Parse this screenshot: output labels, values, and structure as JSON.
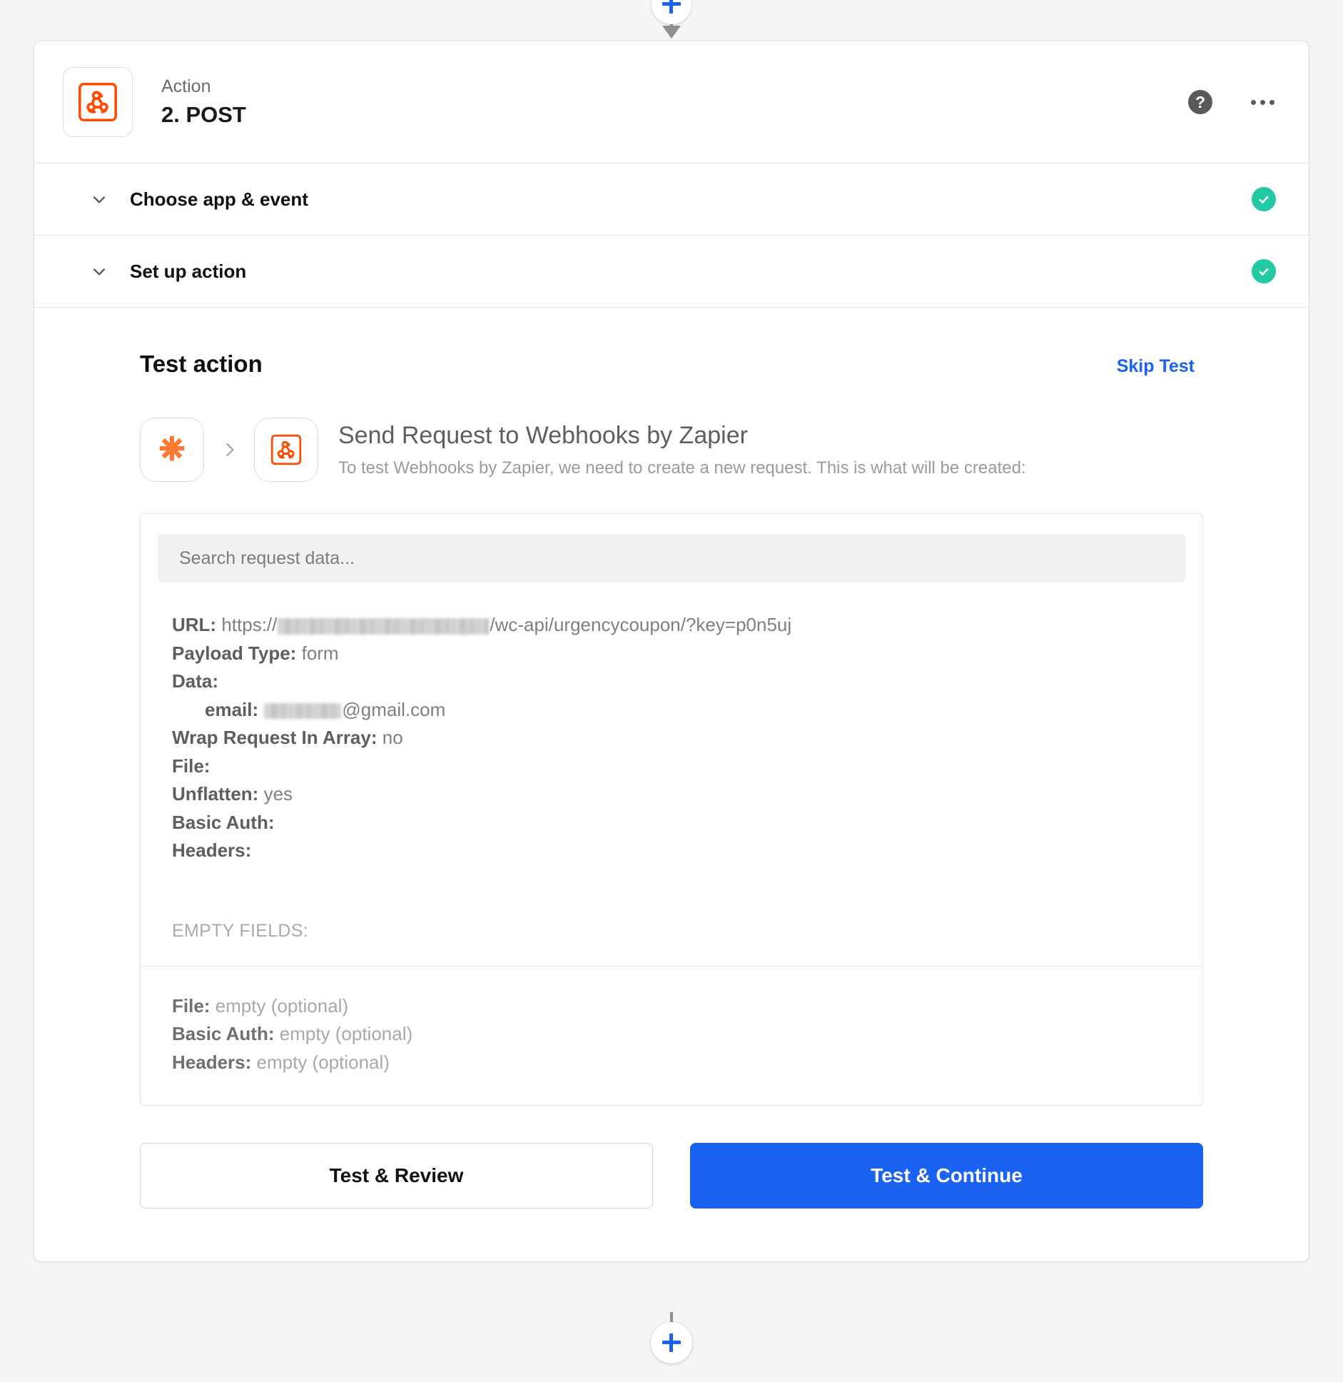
{
  "flow": {
    "add_step_top_label": "+",
    "add_step_bottom_label": "+"
  },
  "header": {
    "kicker": "Action",
    "title": "2. POST",
    "app_icon": "webhooks-icon",
    "help_icon": "?",
    "more_icon": "ellipsis-icon"
  },
  "sections": [
    {
      "label": "Choose app & event",
      "status": "complete",
      "chevron": "chevron-down-icon",
      "check": "✓"
    },
    {
      "label": "Set up action",
      "status": "complete",
      "chevron": "chevron-down-icon",
      "check": "✓"
    }
  ],
  "test_action": {
    "title": "Test action",
    "skip_label": "Skip Test",
    "send_title": "Send Request to Webhooks by Zapier",
    "send_subtitle": "To test Webhooks by Zapier, we need to create a new request. This is what will be created:",
    "zapier_icon": "zapier-logo-icon",
    "arrow_icon": "chevron-right-icon",
    "webhooks_icon": "webhooks-icon",
    "search": {
      "placeholder": "Search request data...",
      "value": ""
    },
    "request_fields": {
      "url_key": "URL:",
      "url_prefix": "https://",
      "url_redacted": true,
      "url_suffix": "/wc-api/urgencycoupon/?key=p0n5uj",
      "payload_type_key": "Payload Type:",
      "payload_type_value": "form",
      "data_key": "Data:",
      "email_key": "email:",
      "email_redacted": true,
      "email_suffix": "@gmail.com",
      "wrap_key": "Wrap Request In Array:",
      "wrap_value": "no",
      "file_key": "File:",
      "file_value": "",
      "unflatten_key": "Unflatten:",
      "unflatten_value": "yes",
      "basic_auth_key": "Basic Auth:",
      "basic_auth_value": "",
      "headers_key": "Headers:",
      "headers_value": ""
    },
    "empty_fields": {
      "heading": "EMPTY FIELDS:",
      "items": [
        {
          "key": "File:",
          "value": "empty (optional)"
        },
        {
          "key": "Basic Auth:",
          "value": "empty (optional)"
        },
        {
          "key": "Headers:",
          "value": "empty (optional)"
        }
      ]
    },
    "buttons": {
      "secondary": "Test & Review",
      "primary": "Test & Continue"
    }
  },
  "colors": {
    "accent_blue": "#1a62f2",
    "brand_orange": "#ff4a00",
    "success_green": "#22c9a3",
    "page_bg": "#f5f5f5"
  }
}
